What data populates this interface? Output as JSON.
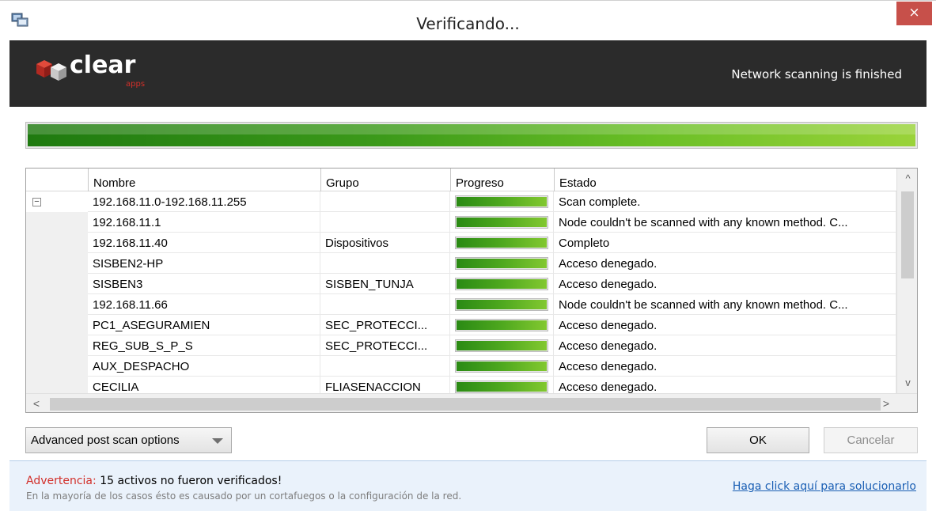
{
  "window": {
    "title": "Verificando...",
    "close_glyph": "×",
    "icon": "computer-scan-icon"
  },
  "header": {
    "logo_text": "clear",
    "logo_sub": "apps",
    "status": "Network scanning is finished",
    "background": "#2b2b2b"
  },
  "overall_progress": 1.0,
  "table": {
    "columns": [
      "Nombre",
      "Grupo",
      "Progreso",
      "Estado"
    ],
    "rows": [
      {
        "nombre": "192.168.11.0-192.168.11.255",
        "grupo": "",
        "progreso": 1.0,
        "estado": "Scan complete.",
        "expandable": true
      },
      {
        "nombre": "192.168.11.1",
        "grupo": "",
        "progreso": 1.0,
        "estado": "Node couldn't be scanned with any known method. C..."
      },
      {
        "nombre": "192.168.11.40",
        "grupo": "Dispositivos",
        "progreso": 1.0,
        "estado": "Completo"
      },
      {
        "nombre": "SISBEN2-HP",
        "grupo": "",
        "progreso": 1.0,
        "estado": "Acceso denegado."
      },
      {
        "nombre": "SISBEN3",
        "grupo": "SISBEN_TUNJA",
        "progreso": 1.0,
        "estado": "Acceso denegado."
      },
      {
        "nombre": "192.168.11.66",
        "grupo": "",
        "progreso": 1.0,
        "estado": "Node couldn't be scanned with any known method. C..."
      },
      {
        "nombre": "PC1_ASEGURAMIEN",
        "grupo": "SEC_PROTECCI...",
        "progreso": 1.0,
        "estado": "Acceso denegado."
      },
      {
        "nombre": "REG_SUB_S_P_S",
        "grupo": "SEC_PROTECCI...",
        "progreso": 1.0,
        "estado": "Acceso denegado."
      },
      {
        "nombre": "AUX_DESPACHO",
        "grupo": "",
        "progreso": 1.0,
        "estado": "Acceso denegado."
      },
      {
        "nombre": "CECILIA",
        "grupo": "FLIASENACCION",
        "progreso": 1.0,
        "estado": "Acceso denegado."
      }
    ]
  },
  "scroll": {
    "up": "^",
    "down": "v",
    "left": "<",
    "right": ">"
  },
  "buttons": {
    "advanced": "Advanced post scan options",
    "ok": "OK",
    "cancel": "Cancelar"
  },
  "warning": {
    "label": "Advertencia:",
    "message": "15 activos no fueron verificados!",
    "detail": "En la mayoría de los casos ésto es causado por un cortafuegos o la configuración de la red.",
    "link": "Haga click aquí para solucionarlo"
  },
  "colors": {
    "progress": "#3c9a1a",
    "warning_label": "#d2302a",
    "link": "#1a5fb4",
    "close": "#c7504a"
  }
}
